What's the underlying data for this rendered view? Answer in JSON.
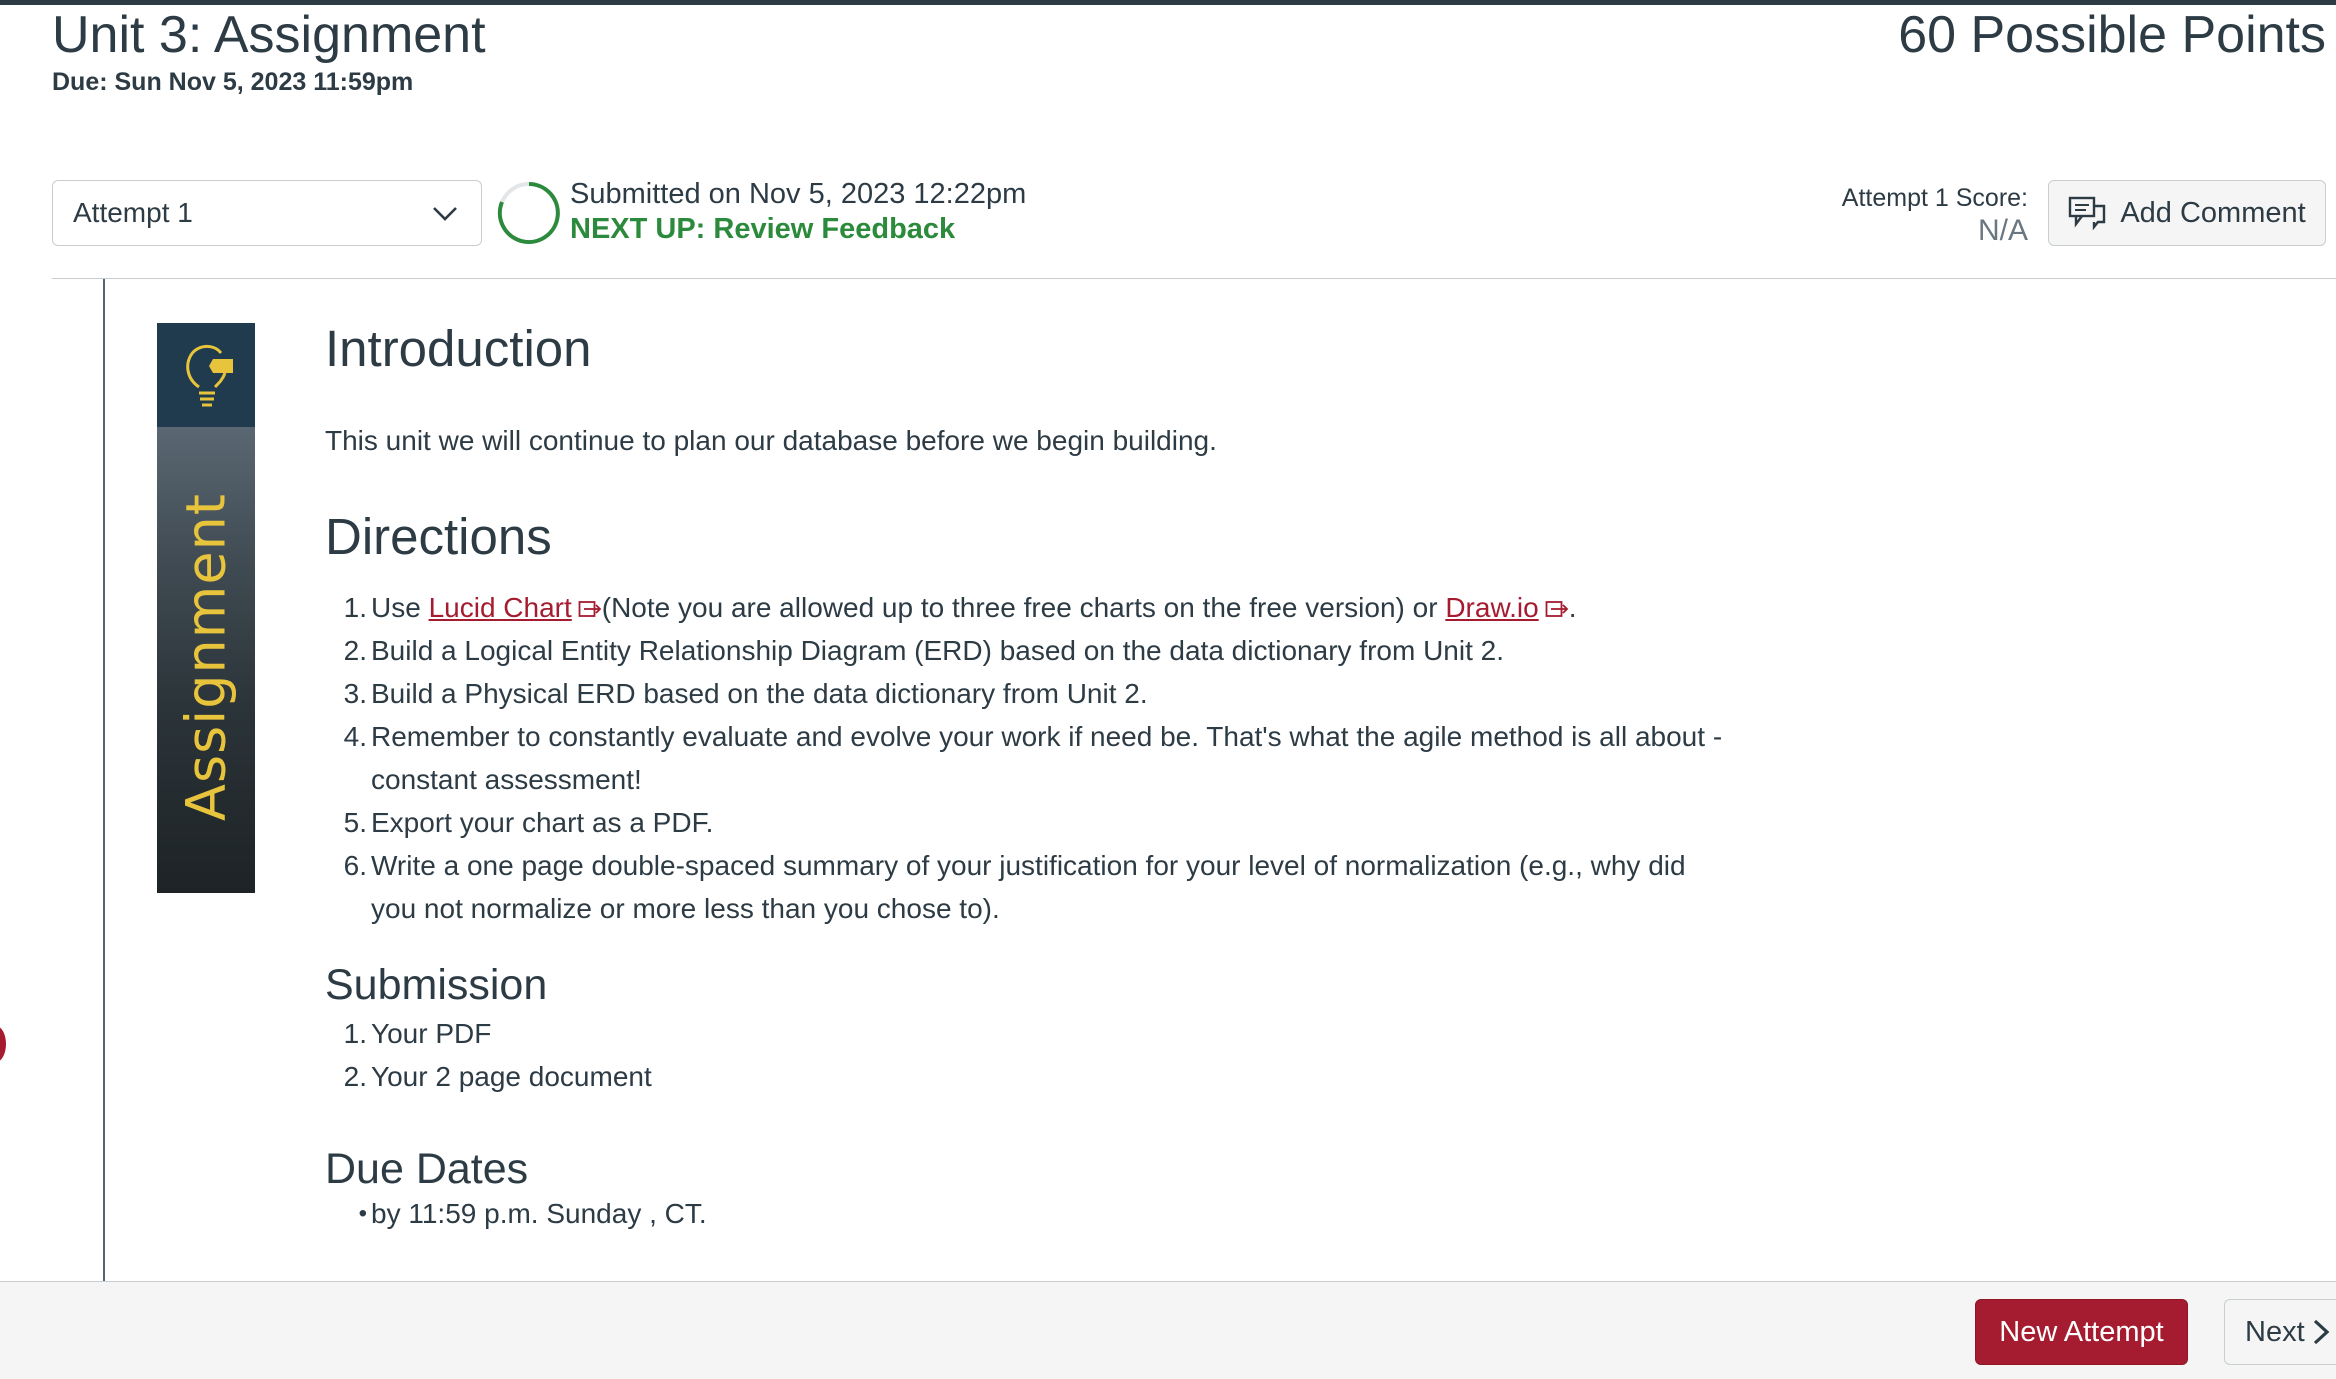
{
  "header": {
    "title": "Unit 3: Assignment",
    "due": "Due: Sun Nov 5, 2023 11:59pm",
    "points": "60 Possible Points"
  },
  "submission": {
    "attempt_selected": "Attempt 1",
    "submitted_text": "Submitted on Nov 5, 2023 12:22pm",
    "next_up": "NEXT UP: Review Feedback",
    "score_label": "Attempt 1 Score:",
    "score_value": "N/A",
    "add_comment_label": "Add Comment"
  },
  "banner": {
    "word": "Assignment"
  },
  "content": {
    "intro_heading": "Introduction",
    "intro_text": "This unit we will continue to plan our database before we begin building.",
    "directions_heading": "Directions",
    "directions": {
      "item1_prefix": "Use ",
      "item1_link1": "Lucid Chart",
      "item1_middle": "(Note you are allowed up to three free charts on the free version) or ",
      "item1_link2": "Draw.io",
      "item1_suffix": ".",
      "item2": "Build a Logical Entity Relationship Diagram (ERD) based on the data dictionary from Unit 2.",
      "item3": "Build a Physical ERD based on the data dictionary from Unit 2.",
      "item4_line1": "Remember to constantly evaluate and evolve your work if need be. That's what the agile method is all about -",
      "item4_line2": "constant assessment!",
      "item5": "Export your chart as a PDF.",
      "item6_line1": "Write a one page double-spaced summary of your justification for your level of normalization (e.g., why did",
      "item6_line2": "you not normalize or more less than you chose to)."
    },
    "submission_heading": "Submission",
    "submission_items": [
      "Your PDF",
      "Your 2 page document"
    ],
    "due_heading": "Due Dates",
    "due_items": [
      "by  11:59 p.m.  Sunday , CT."
    ]
  },
  "footer": {
    "new_attempt_label": "New Attempt",
    "next_label": "Next"
  },
  "colors": {
    "accent_red": "#a51c30",
    "success_green": "#2c8a3c",
    "text": "#2d3b45",
    "banner_gold": "#e7c43c"
  },
  "icons": [
    "chevron-down-icon",
    "progress-ring-icon",
    "comment-icon",
    "external-link-icon",
    "lightbulb-icon",
    "chevron-right-icon"
  ]
}
